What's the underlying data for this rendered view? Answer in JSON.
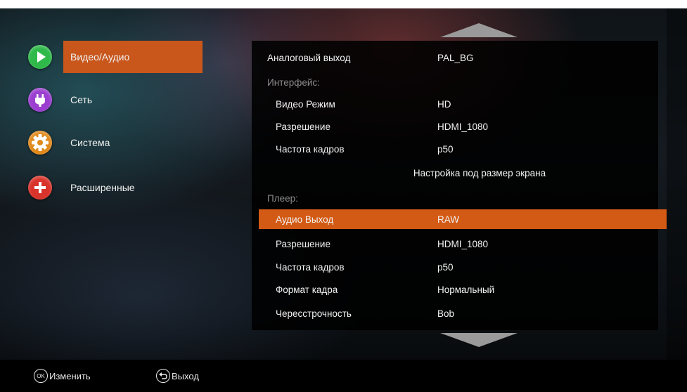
{
  "sidebar": {
    "items": [
      {
        "label": "Видео/Аудио",
        "icon": "play-icon",
        "color": "#2fb94a",
        "active": true
      },
      {
        "label": "Сеть",
        "icon": "network-plug-icon",
        "color": "#9b3fd0",
        "active": false
      },
      {
        "label": "Система",
        "icon": "gear-icon",
        "color": "#e08a1c",
        "active": false
      },
      {
        "label": "Расширенные",
        "icon": "plus-icon",
        "color": "#d9342b",
        "active": false
      }
    ]
  },
  "settings": {
    "analog_output": {
      "label": "Аналоговый выход",
      "value": "PAL_BG"
    },
    "interface_header": "Интерфейс:",
    "video_mode": {
      "label": "Видео Режим",
      "value": "HD"
    },
    "resolution": {
      "label": "Разрешение",
      "value": "HDMI_1080"
    },
    "frame_rate": {
      "label": "Частота кадров",
      "value": "p50"
    },
    "screen_fit": "Настройка под размер экрана",
    "player_header": "Плеер:",
    "audio_output": {
      "label": "Аудио Выход",
      "value": "RAW"
    },
    "player_resolution": {
      "label": "Разрешение",
      "value": "HDMI_1080"
    },
    "player_frame_rate": {
      "label": "Частота кадров",
      "value": "p50"
    },
    "aspect_ratio": {
      "label": "Формат кадра",
      "value": "Нормальный"
    },
    "deinterlace": {
      "label": "Чересстрочность",
      "value": "Bob"
    }
  },
  "footer": {
    "ok_key": "OK",
    "ok_label": "Изменить",
    "exit_label": "Выход"
  },
  "colors": {
    "accent": "#c9561b",
    "highlight": "#d35a14"
  }
}
